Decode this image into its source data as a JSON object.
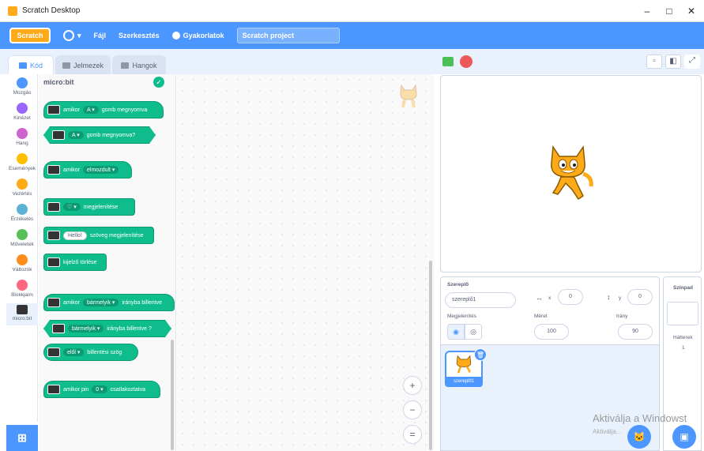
{
  "window": {
    "title": "Scratch Desktop",
    "minimize": "–",
    "maximize": "□",
    "close": "✕"
  },
  "menubar": {
    "logo": "Scratch",
    "file": "Fájl",
    "edit": "Szerkesztés",
    "tutorials": "Gyakorlatok",
    "project_title": "Scratch project"
  },
  "tabs": {
    "code": "Kód",
    "costumes": "Jelmezek",
    "sounds": "Hangok"
  },
  "categories": [
    {
      "label": "Mozgás",
      "color": "#4c97ff"
    },
    {
      "label": "Kinézet",
      "color": "#9966ff"
    },
    {
      "label": "Hang",
      "color": "#cf63cf"
    },
    {
      "label": "Események",
      "color": "#ffbf00"
    },
    {
      "label": "Vezérlés",
      "color": "#ffab19"
    },
    {
      "label": "Érzékelés",
      "color": "#5cb1d6"
    },
    {
      "label": "Műveletek",
      "color": "#59c059"
    },
    {
      "label": "Változók",
      "color": "#ff8c1a"
    },
    {
      "label": "Blokkjaim",
      "color": "#ff6680"
    },
    {
      "label": "micro:bit",
      "color": "#333333"
    }
  ],
  "palette": {
    "header": "micro:bit",
    "blocks": {
      "b1": {
        "pre": "amikor",
        "pill": "A ▾",
        "post": "gomb megnyomva"
      },
      "b2": {
        "pill": "A ▾",
        "post": "gomb megnyomva?"
      },
      "b3": {
        "pre": "amikor",
        "pill": "elmozdult ▾"
      },
      "b4": {
        "pill": "♡ ▾",
        "post": "megjelenítése"
      },
      "b5": {
        "pill": "Hello!",
        "post": "szöveg megjelenítése"
      },
      "b6": {
        "post": "kijelző törlése"
      },
      "b7": {
        "pre": "amikor",
        "pill": "bármelyik ▾",
        "post": "irányba billentve"
      },
      "b8": {
        "pill": "bármelyik ▾",
        "post": "irányba billentve ?"
      },
      "b9": {
        "pill": "elől ▾",
        "post": "billentési szög"
      },
      "b10": {
        "pre": "amikor pin",
        "pill": "0 ▾",
        "post": "csatlakoztatva"
      }
    }
  },
  "zoom": {
    "in": "+",
    "out": "−",
    "reset": "="
  },
  "sprite_info": {
    "sprite_label": "Szereplő",
    "sprite_name": "szereplő1",
    "x_label": "x",
    "x_value": "0",
    "y_label": "y",
    "y_value": "0",
    "show_label": "Megjelenítés",
    "size_label": "Méret",
    "size_value": "100",
    "direction_label": "Irány",
    "direction_value": "90"
  },
  "sprite_list": {
    "thumb_label": "szereplő1"
  },
  "stage_panel": {
    "title": "Színpad",
    "backdrops_label": "Hátterek",
    "backdrops_count": "1"
  },
  "watermark": {
    "line1": "Aktiválja a Windowst",
    "line2": "Aktiválja..."
  }
}
